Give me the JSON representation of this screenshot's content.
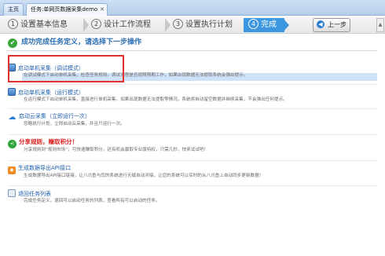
{
  "tabs": {
    "main_label": "主页",
    "task_label": "任务:单网页数据采集demo",
    "close_glyph": "✕"
  },
  "steps": [
    {
      "num": "1",
      "label": "设置基本信息"
    },
    {
      "num": "2",
      "label": "设计工作流程"
    },
    {
      "num": "3",
      "label": "设置执行计划"
    },
    {
      "num": "4",
      "label": "完成"
    }
  ],
  "prev_button": {
    "label": "上一步",
    "icon": "left-arrow-icon"
  },
  "header": {
    "message": "成功完成任务定义，请选择下一步操作",
    "icon": "check-icon"
  },
  "options": [
    {
      "title": "启动单机采集（调试模式）",
      "desc": "在调试模式下启动单机采集，检查任务规则，调试流程是否按照预期工作，如果出现数据无法提取系统会弹出提示。",
      "icon": "computer-icon"
    },
    {
      "title": "启动单机采集（运行模式）",
      "desc": "在运行模式下启动单机采集，直接进行单机采集，如果出现数据无法提取等情况，系统将自动留空数据并继续采集，不会弹出任何提示。",
      "icon": "computer-icon"
    },
    {
      "title": "启动云采集（立即运行一次）",
      "desc": "忽略执行计划，立即启动云采集，并且只运行一次。",
      "icon": "cloud-icon"
    },
    {
      "title": "分享规则，赚取积分！",
      "desc": "分享规则到“规则市场”，可快速赚取积分，还有机会赢取专业版特权，只需几秒，快来试试吧！",
      "icon": "share-icon"
    },
    {
      "title": "生成数据导出API接口",
      "desc": "生成数据导出API接口链接，让八爪鱼与您的系统进行无缝自动对接，让您的系统可以实时的从八爪鱼上自动同步更新数据！",
      "icon": "rss-icon"
    },
    {
      "title": "退回任务列表",
      "desc": "完成任务定义，退回可以启动任务的列表，查看所有可以启动的任务。",
      "icon": "list-icon"
    }
  ],
  "colors": {
    "accent": "#3c96e0",
    "link": "#1e5fb0",
    "highlight": "#e03030",
    "share": "#dd2222"
  }
}
